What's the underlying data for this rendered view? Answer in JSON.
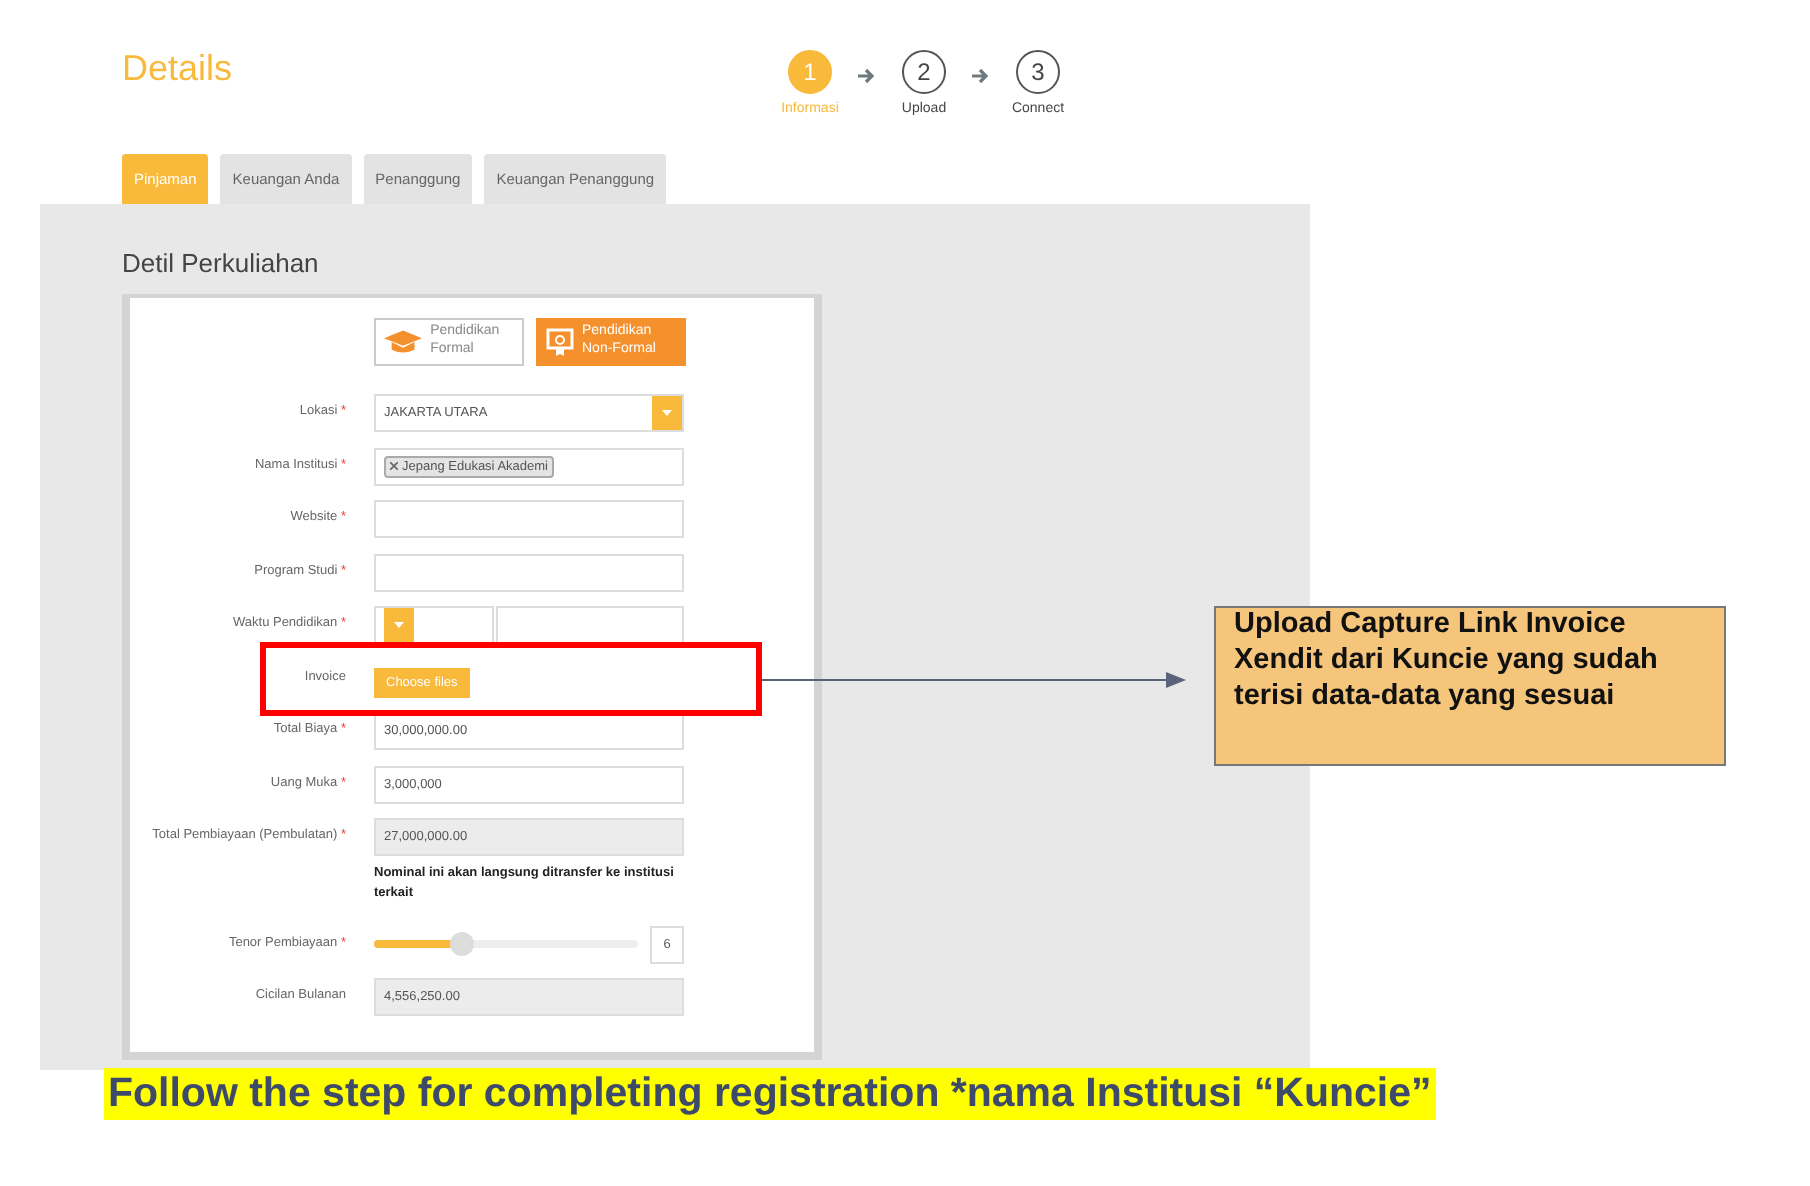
{
  "page": {
    "title": "Details"
  },
  "steps": [
    {
      "number": "1",
      "label": "Informasi",
      "selected": true
    },
    {
      "number": "2",
      "label": "Upload",
      "selected": false
    },
    {
      "number": "3",
      "label": "Connect",
      "selected": false
    }
  ],
  "tabs": [
    {
      "label": "Pinjaman",
      "selected": true
    },
    {
      "label": "Keuangan Anda",
      "selected": false
    },
    {
      "label": "Penanggung",
      "selected": false
    },
    {
      "label": "Keuangan Penanggung",
      "selected": false
    }
  ],
  "section_title": "Detil Perkuliahan",
  "education_types": [
    {
      "label": "Pendidikan Formal",
      "kind": "formal",
      "selected": false
    },
    {
      "label": "Pendidikan Non-Formal",
      "kind": "nonformal",
      "selected": true
    }
  ],
  "fields": [
    {
      "kind": "select",
      "label": "Lokasi",
      "mark": "*",
      "value": "JAKARTA UTARA"
    },
    {
      "kind": "tags",
      "label": "Nama Institusi",
      "mark": "*",
      "tags": [
        "Jepang Edukasi Akademi"
      ]
    },
    {
      "kind": "text",
      "label": "Website",
      "mark": "*"
    },
    {
      "kind": "text",
      "label": "Program Studi",
      "mark": "*"
    },
    {
      "kind": "split",
      "label": "Waktu Pendidikan",
      "mark": "*"
    },
    {
      "kind": "file",
      "label": "Invoice",
      "button": "Choose files"
    },
    {
      "kind": "text",
      "label": "Total Biaya",
      "mark": "*",
      "value": "30,000,000.00"
    },
    {
      "kind": "text",
      "label": "Uang Muka",
      "mark": "*",
      "value": "3,000,000"
    },
    {
      "kind": "readonly",
      "label": "Total Pembiayaan (Pembulatan)",
      "mark": "*",
      "value": "27,000,000.00",
      "note": "Nominal ini akan langsung ditransfer ke institusi terkait"
    },
    {
      "kind": "slider",
      "label": "Tenor Pembiayaan",
      "mark": "*",
      "level": 0.33,
      "value": "6"
    },
    {
      "kind": "readonly",
      "label": "Cicilan Bulanan",
      "value": "4,556,250.00"
    }
  ],
  "annotation": {
    "text": "Upload Capture Link Invoice Xendit dari Kuncie yang sudah terisi data-data yang sesuai"
  },
  "caption": "Follow the step for completing registration *nama Institusi “Kuncie”"
}
